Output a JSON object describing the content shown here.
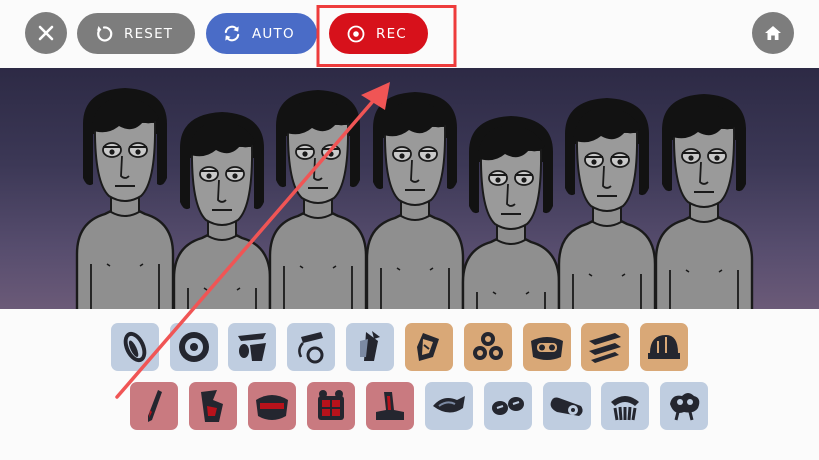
{
  "toolbar": {
    "close_icon": "close-icon",
    "reset_label": "RESET",
    "reset_icon": "reset-icon",
    "auto_label": "AUTO",
    "auto_icon": "auto-loop-icon",
    "rec_label": "REC",
    "rec_icon": "record-icon",
    "home_icon": "home-icon"
  },
  "colors": {
    "gray_button": "#7d7d7d",
    "auto_blue": "#4a6cc7",
    "rec_red": "#d7111b",
    "highlight_red": "#ee3c3c",
    "tile_blue": "#bfcde0",
    "tile_orange": "#d9a877",
    "tile_red": "#c97a80"
  },
  "singers_count": 7,
  "sound_row_1": [
    {
      "icon": "beat-disc-icon",
      "color": "blue"
    },
    {
      "icon": "beat-speaker-icon",
      "color": "blue"
    },
    {
      "icon": "beat-cup-icon",
      "color": "blue"
    },
    {
      "icon": "beat-pedal-icon",
      "color": "blue"
    },
    {
      "icon": "beat-horn-icon",
      "color": "blue"
    },
    {
      "icon": "effect-shard-icon",
      "color": "orange"
    },
    {
      "icon": "effect-rings-icon",
      "color": "orange"
    },
    {
      "icon": "effect-tape-icon",
      "color": "orange"
    },
    {
      "icon": "effect-stripes-icon",
      "color": "orange"
    },
    {
      "icon": "effect-dome-icon",
      "color": "orange"
    }
  ],
  "sound_row_2": [
    {
      "icon": "melody-pen-icon",
      "color": "red"
    },
    {
      "icon": "melody-cup-icon",
      "color": "red"
    },
    {
      "icon": "melody-mask-icon",
      "color": "red"
    },
    {
      "icon": "melody-gift-icon",
      "color": "red"
    },
    {
      "icon": "melody-stamp-icon",
      "color": "red"
    },
    {
      "icon": "voice-fish-icon",
      "color": "blue"
    },
    {
      "icon": "voice-glasses-icon",
      "color": "blue"
    },
    {
      "icon": "voice-capsule-icon",
      "color": "blue"
    },
    {
      "icon": "voice-comb-icon",
      "color": "blue"
    },
    {
      "icon": "voice-cloud-icon",
      "color": "blue"
    }
  ]
}
